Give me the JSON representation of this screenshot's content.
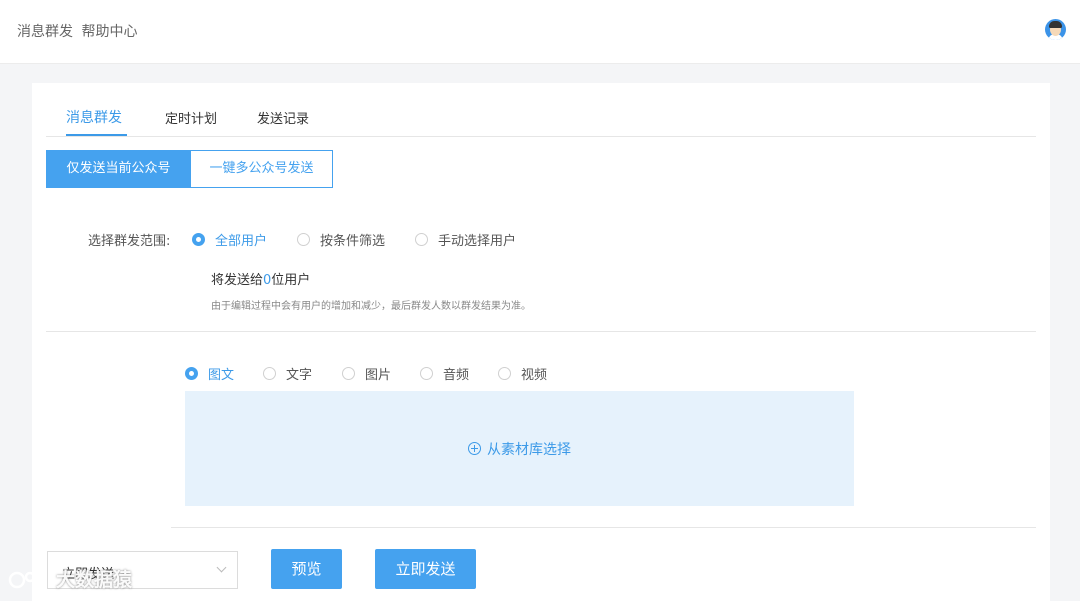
{
  "header": {
    "title": "消息群发",
    "help": "帮助中心"
  },
  "tabs": [
    {
      "label": "消息群发",
      "active": true
    },
    {
      "label": "定时计划",
      "active": false
    },
    {
      "label": "发送记录",
      "active": false
    }
  ],
  "send_mode": {
    "options": [
      "仅发送当前公众号",
      "一键多公众号发送"
    ],
    "selected": "仅发送当前公众号"
  },
  "audience": {
    "label": "选择群发范围:",
    "options": [
      "全部用户",
      "按条件筛选",
      "手动选择用户"
    ],
    "selected": "全部用户",
    "count_prefix": "将发送给",
    "count": "0",
    "count_suffix": "位用户",
    "note": "由于编辑过程中会有用户的增加和减少，最后群发人数以群发结果为准。"
  },
  "content_type": {
    "options": [
      "图文",
      "文字",
      "图片",
      "音频",
      "视频"
    ],
    "selected": "图文"
  },
  "media_picker": {
    "label": "从素材库选择"
  },
  "footer": {
    "timing_select": "立即发送",
    "preview_button": "预览",
    "send_button": "立即发送"
  },
  "watermark": {
    "text": "大数据猿"
  },
  "colors": {
    "accent": "#45a2ef",
    "accent_text": "#3c9ae8",
    "media_bg": "#e6f2fc",
    "page_bg": "#f4f5f7"
  },
  "icons": [
    "avatar",
    "radio-icon",
    "plus-circle-icon",
    "chevron-down-icon",
    "watermark-logo-icon"
  ]
}
